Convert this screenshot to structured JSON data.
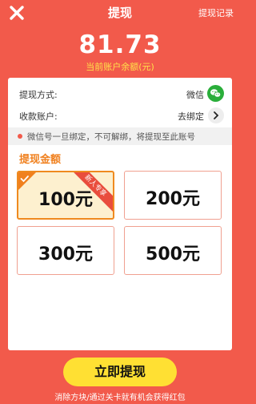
{
  "header": {
    "title": "提现",
    "history_label": "提现记录"
  },
  "balance": {
    "amount": "81.73",
    "label": "当前账户余额(元)"
  },
  "method": {
    "label": "提现方式:",
    "value": "微信"
  },
  "account": {
    "label": "收款账户:",
    "value": "去绑定"
  },
  "notice": "微信号一旦绑定，不可解绑，将提现至此账号",
  "amounts": {
    "title": "提现金额",
    "options": [
      {
        "label": "100元",
        "badge": "新人专享",
        "selected": true
      },
      {
        "label": "200元"
      },
      {
        "label": "300元"
      },
      {
        "label": "500元"
      }
    ]
  },
  "colors": {
    "background": "#f25a4b",
    "accent": "#ffe033",
    "wechat": "#2aae3a"
  },
  "footer": {
    "button_label": "立即提现",
    "hint": "消除方块/通过关卡就有机会获得红包"
  }
}
